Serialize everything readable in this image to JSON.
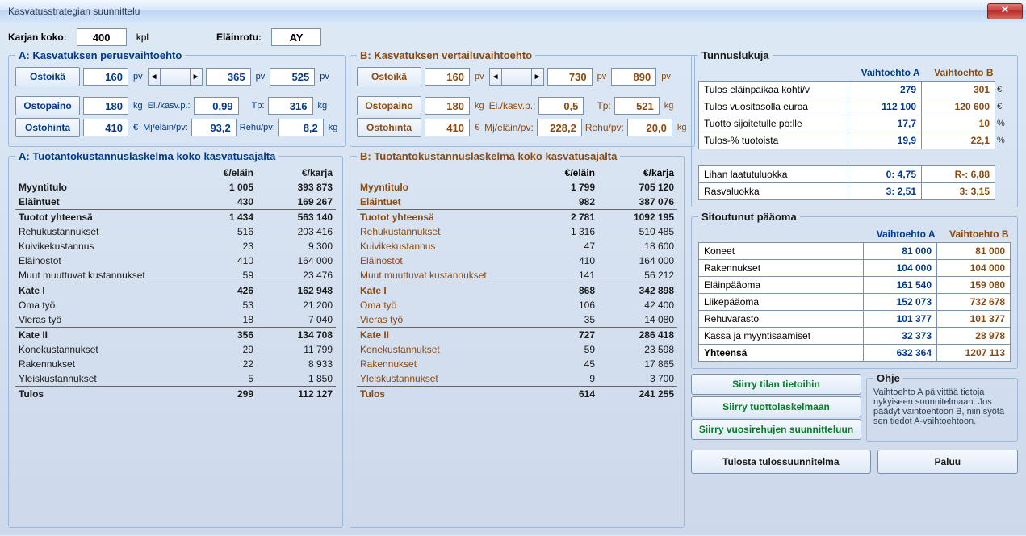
{
  "window_title": "Kasvatusstrategian suunnittelu",
  "top": {
    "karjan_koko_label": "Karjan koko:",
    "karjan_koko": "400",
    "kpl": "kpl",
    "elainrotu_label": "Eläinrotu:",
    "elainrotu": "AY"
  },
  "A": {
    "legend1": "A: Kasvatuksen perusvaihtoehto",
    "ostoika_btn": "Ostoikä",
    "ostoika": "160",
    "days2": "365",
    "days_total": "525",
    "ostopaino_btn": "Ostopaino",
    "ostopaino": "180",
    "elkasvp_label": "El./kasv.p.:",
    "elkasvp": "0,99",
    "tp_label": "Tp:",
    "tp": "316",
    "ostohinta_btn": "Ostohinta",
    "ostohinta": "410",
    "mj_label": "Mj/eläin/pv:",
    "mj": "93,2",
    "rehu_label": "Rehu/pv:",
    "rehu": "8,2",
    "legend2": "A: Tuotantokustannuslaskelma koko kasvatusajalta",
    "h1": "€/eläin",
    "h2": "€/karja",
    "rows": [
      {
        "l": "Myyntitulo",
        "a": "1 005",
        "b": "393 873",
        "bold": true
      },
      {
        "l": "Eläintuet",
        "a": "430",
        "b": "169 267",
        "bold": true
      },
      {
        "hr": true
      },
      {
        "l": "Tuotot yhteensä",
        "a": "1 434",
        "b": "563 140",
        "bold": true
      },
      {
        "l": "Rehukustannukset",
        "a": "516",
        "b": "203 416"
      },
      {
        "l": "Kuivikekustannus",
        "a": "23",
        "b": "9 300"
      },
      {
        "l": "Eläinostot",
        "a": "410",
        "b": "164 000"
      },
      {
        "l": "Muut muuttuvat kustannukset",
        "a": "59",
        "b": "23 476"
      },
      {
        "hr": true
      },
      {
        "l": "Kate I",
        "a": "426",
        "b": "162 948",
        "bold": true
      },
      {
        "l": "Oma työ",
        "a": "53",
        "b": "21 200"
      },
      {
        "l": "Vieras työ",
        "a": "18",
        "b": "7 040"
      },
      {
        "hr": true
      },
      {
        "l": "Kate II",
        "a": "356",
        "b": "134 708",
        "bold": true
      },
      {
        "l": "Konekustannukset",
        "a": "29",
        "b": "11 799"
      },
      {
        "l": "Rakennukset",
        "a": "22",
        "b": "8 933"
      },
      {
        "l": "Yleiskustannukset",
        "a": "5",
        "b": "1 850"
      },
      {
        "hr": true
      },
      {
        "l": "Tulos",
        "a": "299",
        "b": "112 127",
        "bold": true
      }
    ]
  },
  "B": {
    "legend1": "B: Kasvatuksen vertailuvaihtoehto",
    "ostoika_btn": "Ostoikä",
    "ostoika": "160",
    "days2": "730",
    "days_total": "890",
    "ostopaino_btn": "Ostopaino",
    "ostopaino": "180",
    "elkasvp_label": "El./kasv.p.:",
    "elkasvp": "0,5",
    "tp_label": "Tp:",
    "tp": "521",
    "ostohinta_btn": "Ostohinta",
    "ostohinta": "410",
    "mj_label": "Mj/eläin/pv:",
    "mj": "228,2",
    "rehu_label": "Rehu/pv:",
    "rehu": "20,0",
    "legend2": "B: Tuotantokustannuslaskelma koko kasvatusajalta",
    "h1": "€/eläin",
    "h2": "€/karja",
    "rows": [
      {
        "l": "Myyntitulo",
        "a": "1 799",
        "b": "705 120",
        "bold": true
      },
      {
        "l": "Eläintuet",
        "a": "982",
        "b": "387 076",
        "bold": true
      },
      {
        "hr": true
      },
      {
        "l": "Tuotot yhteensä",
        "a": "2 781",
        "b": "1092 195",
        "bold": true
      },
      {
        "l": "Rehukustannukset",
        "a": "1 316",
        "b": "510 485"
      },
      {
        "l": "Kuivikekustannus",
        "a": "47",
        "b": "18 600"
      },
      {
        "l": "Eläinostot",
        "a": "410",
        "b": "164 000"
      },
      {
        "l": "Muut muuttuvat kustannukset",
        "a": "141",
        "b": "56 212"
      },
      {
        "hr": true
      },
      {
        "l": "Kate I",
        "a": "868",
        "b": "342 898",
        "bold": true
      },
      {
        "l": "Oma työ",
        "a": "106",
        "b": "42 400"
      },
      {
        "l": "Vieras työ",
        "a": "35",
        "b": "14 080"
      },
      {
        "hr": true
      },
      {
        "l": "Kate II",
        "a": "727",
        "b": "286 418",
        "bold": true
      },
      {
        "l": "Konekustannukset",
        "a": "59",
        "b": "23 598"
      },
      {
        "l": "Rakennukset",
        "a": "45",
        "b": "17 865"
      },
      {
        "l": "Yleiskustannukset",
        "a": "9",
        "b": "3 700"
      },
      {
        "hr": true
      },
      {
        "l": "Tulos",
        "a": "614",
        "b": "241 255",
        "bold": true
      }
    ]
  },
  "tun": {
    "legend": "Tunnuslukuja",
    "hA": "Vaihtoehto A",
    "hB": "Vaihtoehto B",
    "rows": [
      {
        "l": "Tulos eläinpaikaa kohti/v",
        "a": "279",
        "b": "301",
        "u": "€"
      },
      {
        "l": "Tulos vuositasolla euroa",
        "a": "112 100",
        "b": "120 600",
        "u": "€"
      },
      {
        "l": "Tuotto sijoitetulle po:lle",
        "a": "17,7",
        "b": "10",
        "u": "%"
      },
      {
        "l": "Tulos-% tuotoista",
        "a": "19,9",
        "b": "22,1",
        "u": "%"
      },
      {
        "gap": true
      },
      {
        "l": "Lihan laatutuluokka",
        "a": "0:  4,75",
        "b": "R-:  6,88",
        "u": ""
      },
      {
        "l": "Rasvaluokka",
        "a": "3:  2,51",
        "b": "3:  3,15",
        "u": ""
      }
    ]
  },
  "sit": {
    "legend": "Sitoutunut pääoma",
    "hA": "Vaihtoehto A",
    "hB": "Vaihtoehto B",
    "rows": [
      {
        "l": "Koneet",
        "a": "81 000",
        "b": "81 000"
      },
      {
        "l": "Rakennukset",
        "a": "104 000",
        "b": "104 000"
      },
      {
        "l": "Eläinpääoma",
        "a": "161 540",
        "b": "159 080"
      },
      {
        "l": "Liikepääoma",
        "a": "152 073",
        "b": "732 678"
      },
      {
        "l": "Rehuvarasto",
        "a": "101 377",
        "b": "101 377"
      },
      {
        "l": "Kassa ja myyntisaamiset",
        "a": "32 373",
        "b": "28 978"
      },
      {
        "l": "Yhteensä",
        "a": "632 364",
        "b": "1207 113",
        "bold": true
      }
    ]
  },
  "nav": {
    "b1": "Siirry tilan tietoihin",
    "b2": "Siirry tuottolaskelmaan",
    "b3": "Siirry vuosirehujen suunnitteluun",
    "ohje_legend": "Ohje",
    "ohje": "Vaihtoehto A päivittää tietoja nykyiseen suunnitelmaan. Jos päädyt vaihtoehtoon B, niin syötä sen tiedot A-vaihtoehtoon."
  },
  "bottom": {
    "b1": "Tulosta tulossuunnitelma",
    "b2": "Paluu"
  }
}
